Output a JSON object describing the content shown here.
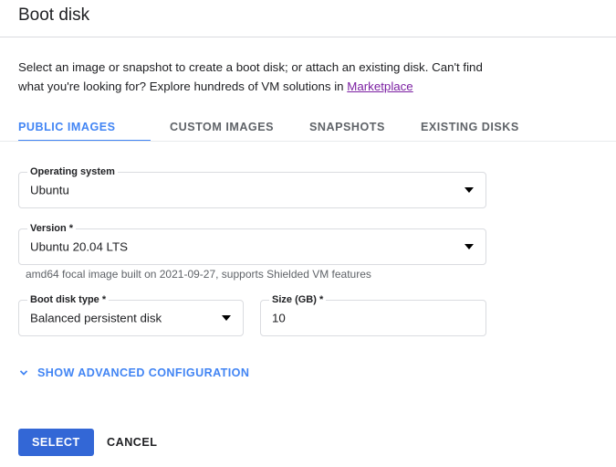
{
  "dialog": {
    "title": "Boot disk"
  },
  "description": {
    "part1": "Select an image or snapshot to create a boot disk; or attach an existing disk. Can't find what you're looking for? Explore hundreds of VM solutions in ",
    "link_label": "Marketplace",
    "link_color": "#7b1fa2"
  },
  "tabs": {
    "active_index": 0,
    "items": [
      {
        "label": "PUBLIC IMAGES",
        "active": true
      },
      {
        "label": "CUSTOM IMAGES",
        "active": false
      },
      {
        "label": "SNAPSHOTS",
        "active": false
      },
      {
        "label": "EXISTING DISKS",
        "active": false
      }
    ],
    "active_color": "#4285f4",
    "inactive_color": "#5f6368"
  },
  "form": {
    "operating_system": {
      "label": "Operating system",
      "value": "Ubuntu",
      "icon": "chevron-down-icon"
    },
    "version": {
      "label": "Version *",
      "value": "Ubuntu 20.04 LTS",
      "icon": "chevron-down-icon",
      "hint": "amd64 focal image built on 2021-09-27, supports Shielded VM features"
    },
    "boot_disk_type": {
      "label": "Boot disk type *",
      "value": "Balanced persistent disk",
      "icon": "chevron-down-icon"
    },
    "size_gb": {
      "label": "Size (GB) *",
      "value": "10"
    }
  },
  "advanced": {
    "label": "SHOW ADVANCED CONFIGURATION",
    "icon": "chevron-down-icon",
    "color": "#4285f4"
  },
  "footer": {
    "select_label": "SELECT",
    "cancel_label": "CANCEL",
    "primary_color": "#3367d6"
  }
}
